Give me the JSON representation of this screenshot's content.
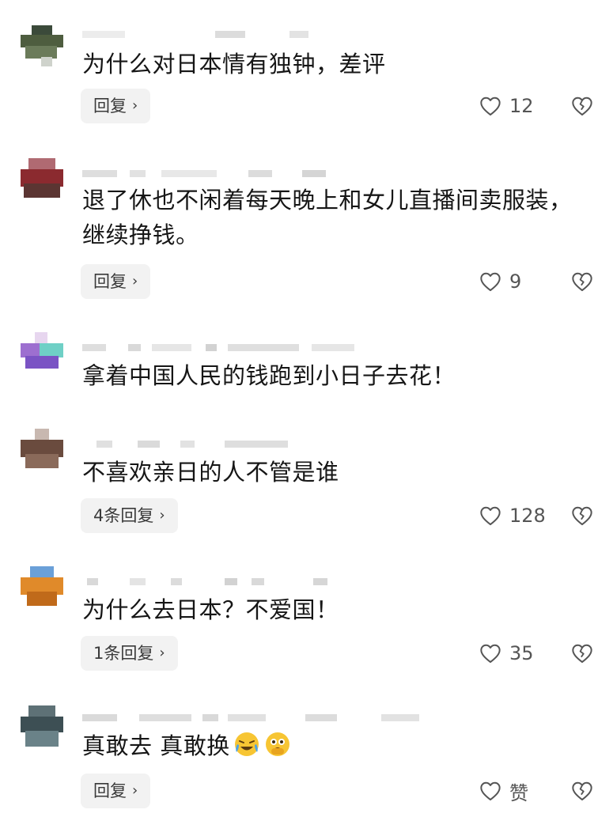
{
  "comments": [
    {
      "text": "为什么对日本情有独钟，差评",
      "reply_label": "回复",
      "likes": "12"
    },
    {
      "text": "退了休也不闲着每天晚上和女儿直播间卖服装，继续挣钱。",
      "reply_label": "回复",
      "likes": "9"
    },
    {
      "text": "拿着中国人民的钱跑到小日子去花！"
    },
    {
      "text": "不喜欢亲日的人不管是谁",
      "reply_label": "4条回复",
      "likes": "128"
    },
    {
      "text": "为什么去日本？不爱国！",
      "reply_label": "1条回复",
      "likes": "35"
    },
    {
      "text": "真敢去 真敢换",
      "emojis": [
        "laughing-crying-emoji",
        "peeking-emoji"
      ],
      "reply_label": "回复",
      "likes": "赞"
    }
  ],
  "colors": {
    "text": "#161616",
    "secondary": "#555555",
    "button_bg": "#f2f2f2",
    "placeholder": "#d9d9d9"
  }
}
